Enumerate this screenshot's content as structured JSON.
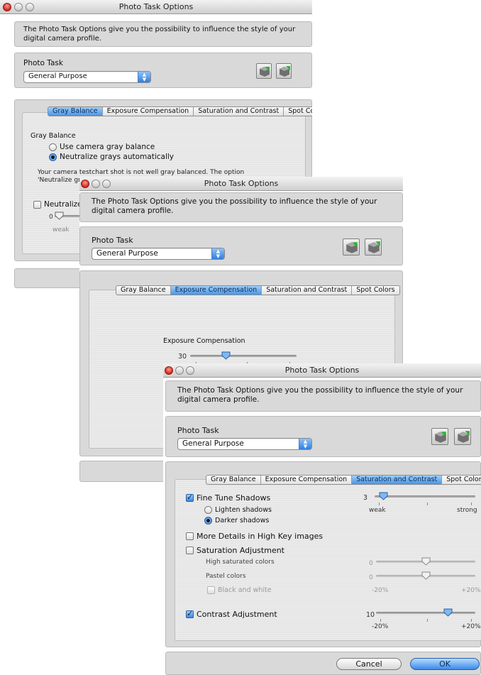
{
  "window1": {
    "title": "Photo Task Options",
    "intro": "The Photo Task Options give you the possibility to influence the style of your digital camera profile.",
    "photo_task_label": "Photo Task",
    "photo_task_value": "General Purpose",
    "tabs": [
      "Gray Balance",
      "Exposure Compensation",
      "Saturation and Contrast",
      "Spot Colors"
    ],
    "active_tab": "Gray Balance",
    "group_title": "Gray Balance",
    "radio_camera": "Use camera gray balance",
    "radio_neutralize": "Neutralize grays automatically",
    "help": "Your camera testchart shot is not well gray balanced. The option 'Neutralize grays automatically' is",
    "neutralize_check": "Neutralize to",
    "slider_value": "0",
    "slider_min_label": "weak"
  },
  "window2": {
    "title": "Photo Task Options",
    "intro": "The Photo Task Options give you the possibility to influence the style of your digital camera profile.",
    "photo_task_label": "Photo Task",
    "photo_task_value": "General Purpose",
    "tabs": [
      "Gray Balance",
      "Exposure Compensation",
      "Saturation and Contrast",
      "Spot Colors"
    ],
    "active_tab": "Exposure Compensation",
    "exposure_label": "Exposure Compensation",
    "exposure_value": "30",
    "exposure_fraction": 0.32
  },
  "window3": {
    "title": "Photo Task Options",
    "intro": "The Photo Task Options give you the possibility to influence the style of your digital camera profile.",
    "photo_task_label": "Photo Task",
    "photo_task_value": "General Purpose",
    "tabs": [
      "Gray Balance",
      "Exposure Compensation",
      "Saturation and Contrast",
      "Spot Colors"
    ],
    "active_tab": "Saturation and Contrast",
    "fine_tune": {
      "label": "Fine Tune Shadows",
      "checked": true,
      "value": "3",
      "fraction": 0.05,
      "min_label": "weak",
      "max_label": "strong"
    },
    "lighten": "Lighten shadows",
    "darker": "Darker shadows",
    "more_details": "More Details in High Key images",
    "saturation": "Saturation Adjustment",
    "high_sat": {
      "label": "High saturated colors",
      "value": "0",
      "fraction": 0.5
    },
    "pastel": {
      "label": "Pastel colors",
      "value": "0",
      "fraction": 0.5,
      "min_label": "-20%",
      "max_label": "+20%"
    },
    "bw": "Black and white",
    "contrast": {
      "label": "Contrast Adjustment",
      "checked": true,
      "value": "10",
      "fraction": 0.75,
      "min_label": "-20%",
      "max_label": "+20%"
    },
    "cancel": "Cancel",
    "ok": "OK"
  },
  "colors": {
    "accent": "#3a86e0",
    "close": "#d2261c"
  },
  "icons": {
    "toolbar_left": "profile-load-icon",
    "toolbar_right": "profile-save-icon"
  }
}
